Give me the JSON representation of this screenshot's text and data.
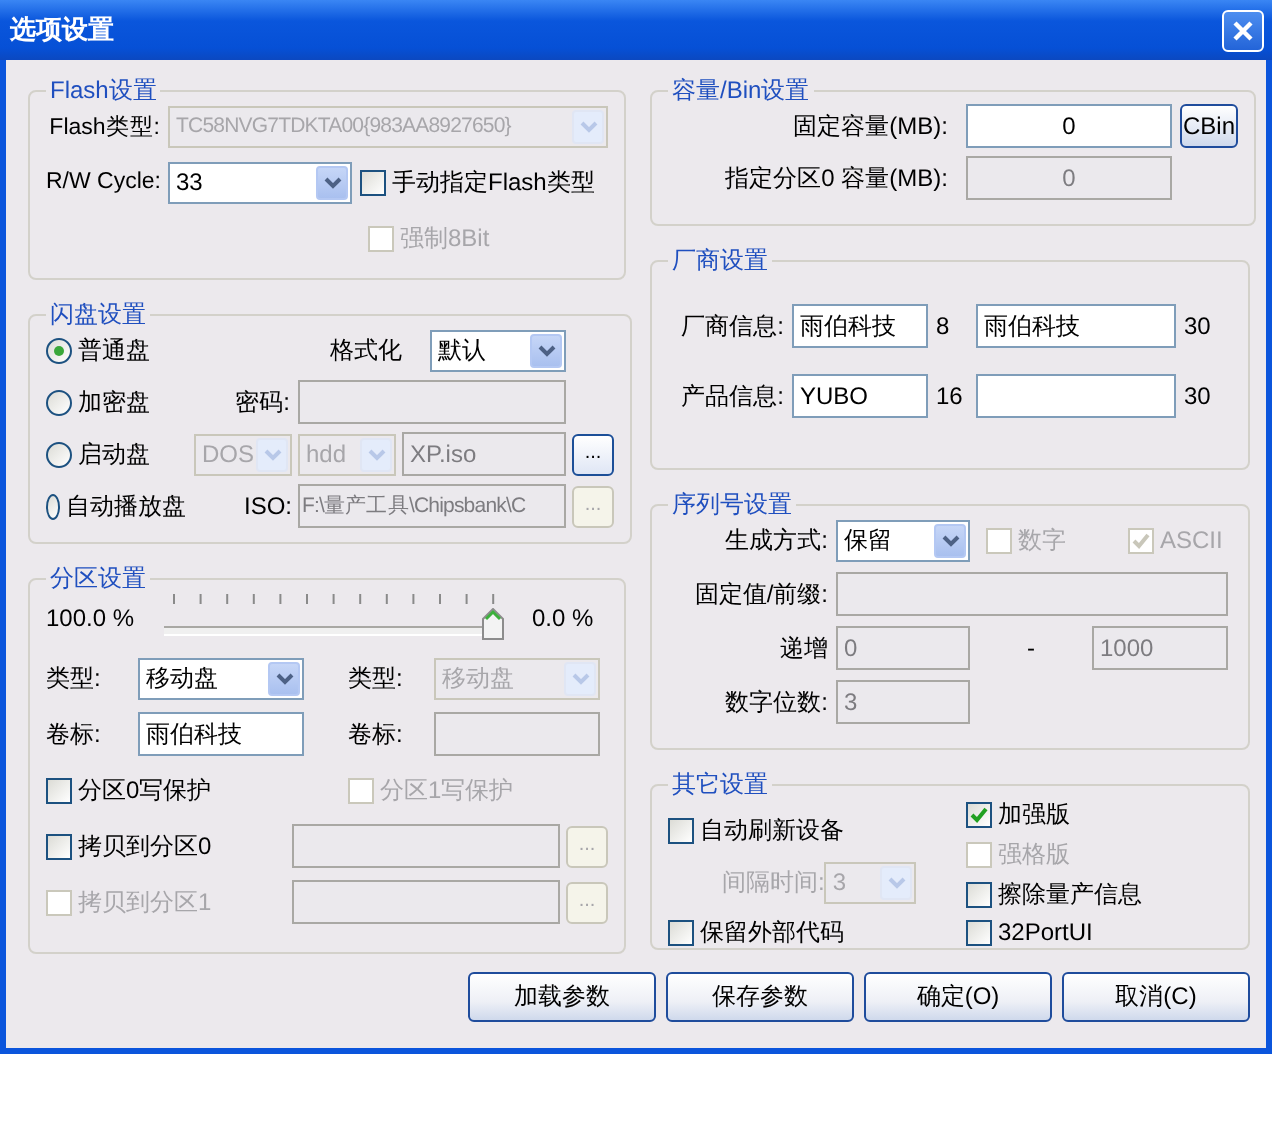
{
  "window": {
    "title": "选项设置"
  },
  "flash": {
    "title": "Flash设置",
    "type_label": "Flash类型:",
    "type_combo": {
      "value": "TC58NVG7TDKTA00{983AA8927650}",
      "disabled": true
    },
    "cycle_label": "R/W Cycle:",
    "cycle_combo": {
      "value": "33",
      "disabled": false
    },
    "manual": {
      "label": "手动指定Flash类型",
      "checked": false,
      "disabled": false
    },
    "force8": {
      "label": "强制8Bit",
      "checked": false,
      "disabled": true
    }
  },
  "disk": {
    "title": "闪盘设置",
    "modes": [
      {
        "label": "普通盘",
        "selected": true
      },
      {
        "label": "加密盘",
        "selected": false
      },
      {
        "label": "启动盘",
        "selected": false
      },
      {
        "label": "自动播放盘",
        "selected": false
      }
    ],
    "format_label": "格式化",
    "format_combo": {
      "value": "默认",
      "disabled": false
    },
    "password_label": "密码:",
    "password_field": {
      "disabled": true
    },
    "boot_os": {
      "value": "DOS",
      "disabled": true
    },
    "boot_dev": {
      "value": "hdd",
      "disabled": true
    },
    "boot_file": {
      "value": "XP.iso",
      "disabled": true
    },
    "boot_browse": {
      "label": "...",
      "disabled": false
    },
    "iso_label": "ISO:",
    "iso_field": {
      "value": "F:\\量产工具\\Chipsbank\\C",
      "disabled": true
    },
    "iso_browse": {
      "label": "...",
      "disabled": true
    }
  },
  "partition": {
    "title": "分区设置",
    "left_reading": "100.0 %",
    "level": 1,
    "right_reading": "0.0 %",
    "parts": [
      {
        "type_label": "类型:",
        "type_combo": {
          "value": "移动盘",
          "disabled": false
        },
        "volume_label": "卷标:",
        "volume_field": {
          "value": "雨伯科技",
          "disabled": false
        },
        "protect": {
          "label": "分区0写保护",
          "checked": false,
          "disabled": false
        }
      },
      {
        "type_label": "类型:",
        "type_combo": {
          "value": "移动盘",
          "disabled": true
        },
        "volume_label": "卷标:",
        "volume_field": {
          "disabled": true
        },
        "protect": {
          "label": "分区1写保护",
          "checked": false,
          "disabled": true
        }
      }
    ],
    "copies": [
      {
        "check": {
          "label": "拷贝到分区0",
          "checked": false,
          "disabled": false
        },
        "field": {
          "disabled": true
        },
        "browse": {
          "label": "...",
          "disabled": true
        }
      },
      {
        "check": {
          "label": "拷贝到分区1",
          "checked": false,
          "disabled": true
        },
        "field": {
          "disabled": true
        },
        "browse": {
          "label": "...",
          "disabled": true
        }
      }
    ]
  },
  "capacity": {
    "title": "容量/Bin设置",
    "fixed_label": "固定容量(MB):",
    "fixed_field": {
      "value": "0",
      "disabled": false
    },
    "cbin_button": "CBin",
    "part0_label": "指定分区0 容量(MB):",
    "part0_field": {
      "value": "0",
      "disabled": true
    }
  },
  "vendor": {
    "title": "厂商设置",
    "rows": [
      {
        "label": "厂商信息:",
        "field1": {
          "value": "雨伯科技",
          "disabled": false
        },
        "count1": "8",
        "field2": {
          "value": "雨伯科技",
          "disabled": false
        },
        "count2": "30"
      },
      {
        "label": "产品信息:",
        "field1": {
          "value": "YUBO",
          "disabled": false
        },
        "count1": "16",
        "field2": {
          "disabled": false
        },
        "count2": "30"
      }
    ]
  },
  "serial": {
    "title": "序列号设置",
    "mode_label": "生成方式:",
    "mode_combo": {
      "value": "保留",
      "disabled": false
    },
    "digits": {
      "label": "数字",
      "checked": false,
      "disabled": true
    },
    "ascii": {
      "label": "ASCII",
      "checked": true,
      "disabled": true
    },
    "prefix_label": "固定值/前缀:",
    "prefix_field": {
      "disabled": true
    },
    "inc_label": "递增",
    "inc_from": {
      "value": "0",
      "disabled": true
    },
    "dash": "-",
    "inc_to": {
      "value": "1000",
      "disabled": true
    },
    "width_label": "数字位数:",
    "width_field": {
      "value": "3",
      "disabled": true
    }
  },
  "other": {
    "title": "其它设置",
    "auto_refresh": {
      "label": "自动刷新设备",
      "checked": false,
      "disabled": false
    },
    "interval_label": "间隔时间:",
    "interval_combo": {
      "value": "3",
      "disabled": true
    },
    "keep_code": {
      "label": "保留外部代码",
      "checked": false,
      "disabled": false
    },
    "enhanced": {
      "label": "加强版",
      "checked": true,
      "disabled": false
    },
    "strict": {
      "label": "强格版",
      "checked": false,
      "disabled": true
    },
    "erase": {
      "label": "擦除量产信息",
      "checked": false,
      "disabled": false
    },
    "port32": {
      "label": "32PortUI",
      "checked": false,
      "disabled": false
    }
  },
  "buttons": [
    "加载参数",
    "保存参数",
    "确定(O)",
    "取消(C)"
  ]
}
